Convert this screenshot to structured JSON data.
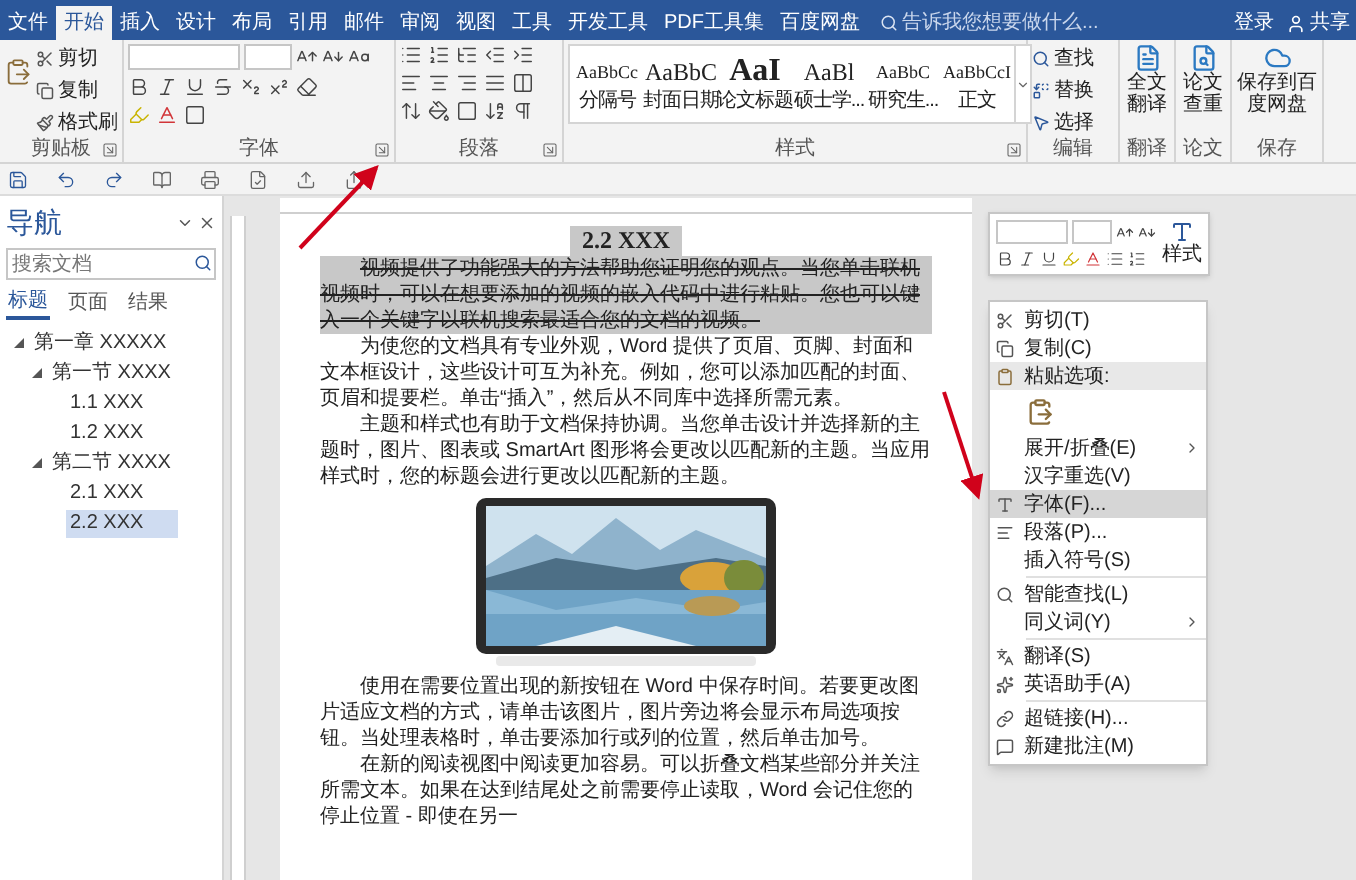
{
  "ribbon": {
    "tabs": [
      {
        "label": "文件",
        "selected": false
      },
      {
        "label": "开始",
        "selected": true
      },
      {
        "label": "插入",
        "selected": false
      },
      {
        "label": "设计",
        "selected": false
      },
      {
        "label": "布局",
        "selected": false
      },
      {
        "label": "引用",
        "selected": false
      },
      {
        "label": "邮件",
        "selected": false
      },
      {
        "label": "审阅",
        "selected": false
      },
      {
        "label": "视图",
        "selected": false
      },
      {
        "label": "工具",
        "selected": false
      },
      {
        "label": "开发工具",
        "selected": false
      },
      {
        "label": "PDF工具集",
        "selected": false
      },
      {
        "label": "百度网盘",
        "selected": false
      }
    ],
    "search": {
      "placeholder": "告诉我您想要做什么..."
    },
    "login": "登录",
    "share": "共享",
    "clipboard": {
      "label": "剪贴板",
      "items": [
        "剪切",
        "复制",
        "格式刷"
      ]
    },
    "font": {
      "label": "字体"
    },
    "paragraph": {
      "label": "段落"
    },
    "styles": {
      "label": "样式",
      "items": [
        {
          "preview": "AaBbCc",
          "name": "分隔号",
          "kind": "normal"
        },
        {
          "preview": "AaBbC",
          "name": "封面日期",
          "kind": "medium"
        },
        {
          "preview": "AaI",
          "name": "论文标题",
          "kind": "large"
        },
        {
          "preview": "AaBl",
          "name": "硕士学...",
          "kind": "medium"
        },
        {
          "preview": "AaBbC",
          "name": "研究生...",
          "kind": "normal"
        },
        {
          "preview": "AaBbCcI",
          "name": "正文",
          "kind": "normal"
        }
      ]
    },
    "editing": {
      "label": "编辑",
      "items": [
        "查找",
        "替换",
        "选择"
      ]
    },
    "tools": [
      {
        "button": "全文翻译",
        "label": "翻译"
      },
      {
        "button": "论文查重",
        "label": "论文"
      },
      {
        "button": "保存到百度网盘",
        "label": "保存"
      }
    ]
  },
  "navigation": {
    "title": "导航",
    "search": {
      "placeholder": "搜索文档"
    },
    "tabs": [
      {
        "label": "标题",
        "selected": true
      },
      {
        "label": "页面",
        "selected": false
      },
      {
        "label": "结果",
        "selected": false
      }
    ],
    "tree": [
      {
        "label": "第一章 XXXXX",
        "expanded": true,
        "selected": false,
        "children": [
          {
            "label": "第一节 XXXX",
            "expanded": true,
            "selected": false,
            "children": [
              {
                "label": "1.1 XXX",
                "selected": false
              },
              {
                "label": "1.2 XXX",
                "selected": false
              }
            ]
          },
          {
            "label": "第二节 XXXX",
            "expanded": true,
            "selected": false,
            "children": [
              {
                "label": "2.1 XXX",
                "selected": false
              },
              {
                "label": "2.2 XXX",
                "selected": true
              }
            ]
          }
        ]
      }
    ]
  },
  "document": {
    "heading": {
      "text": "2.2 XXX",
      "selected": true
    },
    "blocks": [
      {
        "kind": "paragraph",
        "text": "视频提供了功能强大的方法帮助您证明您的观点。当您单击联机视频时，可以在想要添加的视频的嵌入代码中进行粘贴。您也可以键入一个关键字以联机搜索最适合您的文档的视频。",
        "selected": true,
        "strikethrough": true
      },
      {
        "kind": "paragraph",
        "text": "为使您的文档具有专业外观，Word 提供了页眉、页脚、封面和文本框设计，这些设计可互为补充。例如，您可以添加匹配的封面、页眉和提要栏。单击“插入”，然后从不同库中选择所需元素。",
        "selected": false,
        "strikethrough": false
      },
      {
        "kind": "paragraph",
        "text": "主题和样式也有助于文档保持协调。当您单击设计并选择新的主题时，图片、图表或 SmartArt 图形将会更改以匹配新的主题。当应用样式时，您的标题会进行更改以匹配新的主题。",
        "selected": false,
        "strikethrough": false
      },
      {
        "kind": "picture"
      },
      {
        "kind": "paragraph",
        "text": "使用在需要位置出现的新按钮在 Word 中保存时间。若要更改图片适应文档的方式，请单击该图片，图片旁边将会显示布局选项按钮。当处理表格时，单击要添加行或列的位置，然后单击加号。",
        "selected": false,
        "strikethrough": false
      },
      {
        "kind": "paragraph",
        "text": "在新的阅读视图中阅读更加容易。可以折叠文档某些部分并关注所需文本。如果在达到结尾处之前需要停止读取，Word 会记住您的停止位置 - 即使在另一",
        "selected": false,
        "strikethrough": false
      }
    ]
  },
  "mini_toolbar": {
    "styles_button": "样式"
  },
  "context_menu": {
    "items": [
      {
        "kind": "item",
        "label": "剪切(T)",
        "submenu": false,
        "selected": false
      },
      {
        "kind": "item",
        "label": "复制(C)",
        "submenu": false,
        "selected": false
      },
      {
        "kind": "header",
        "label": "粘贴选项:"
      },
      {
        "kind": "paste-option"
      },
      {
        "kind": "item",
        "label": "展开/折叠(E)",
        "submenu": true,
        "selected": false
      },
      {
        "kind": "item",
        "label": "汉字重选(V)",
        "submenu": false,
        "selected": false
      },
      {
        "kind": "item",
        "label": "字体(F)...",
        "submenu": false,
        "selected": true
      },
      {
        "kind": "item",
        "label": "段落(P)...",
        "submenu": false,
        "selected": false
      },
      {
        "kind": "item",
        "label": "插入符号(S)",
        "submenu": false,
        "selected": false
      },
      {
        "kind": "separator"
      },
      {
        "kind": "item",
        "label": "智能查找(L)",
        "submenu": false,
        "selected": false
      },
      {
        "kind": "item",
        "label": "同义词(Y)",
        "submenu": true,
        "selected": false
      },
      {
        "kind": "separator"
      },
      {
        "kind": "item",
        "label": "翻译(S)",
        "submenu": false,
        "selected": false
      },
      {
        "kind": "item",
        "label": "英语助手(A)",
        "submenu": false,
        "selected": false
      },
      {
        "kind": "separator"
      },
      {
        "kind": "item",
        "label": "超链接(H)...",
        "submenu": false,
        "selected": false
      },
      {
        "kind": "item",
        "label": "新建批注(M)",
        "submenu": false,
        "selected": false
      }
    ]
  }
}
